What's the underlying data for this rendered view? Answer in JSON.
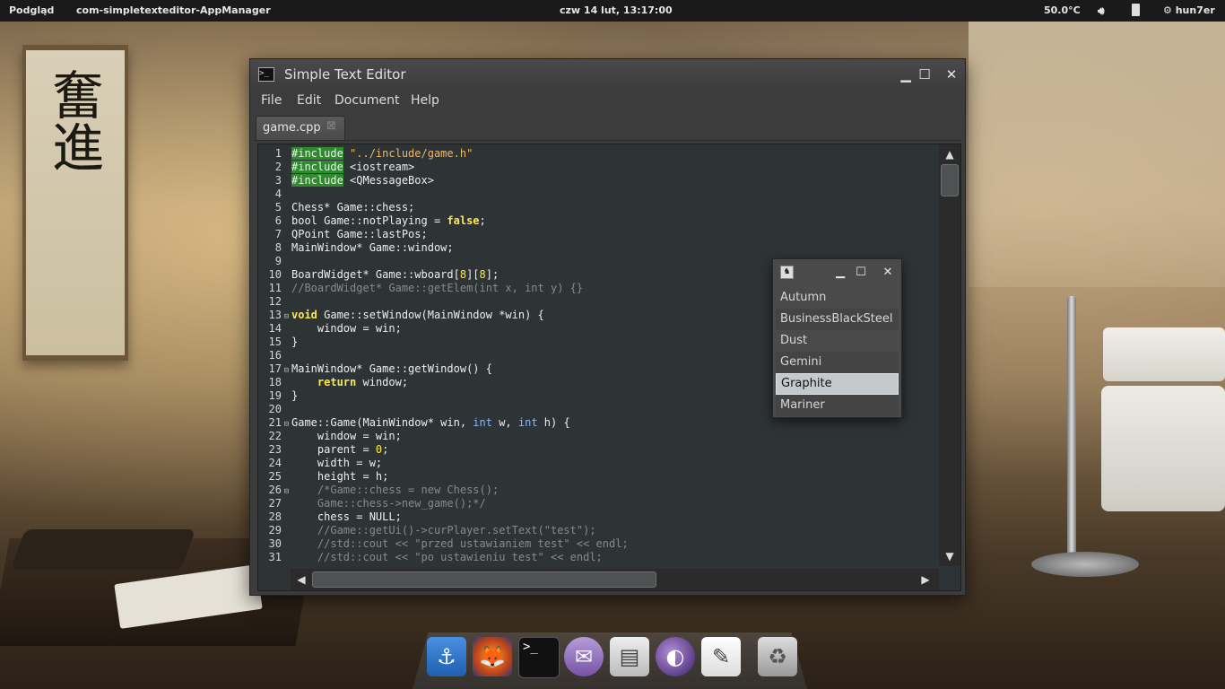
{
  "panel": {
    "app_menu": "Podgląd",
    "active_app": "com-simpletexteditor-AppManager",
    "clock": "czw 14 lut, 13:17:00",
    "temperature": "50.0°C",
    "volume_icon": "speaker-icon",
    "battery_icon": "battery-icon",
    "user": "hun7er"
  },
  "window": {
    "title": "Simple Text Editor",
    "menu": [
      "File",
      "Edit",
      "Document",
      "Help"
    ],
    "tab": {
      "label": "game.cpp",
      "close_icon": "close-icon"
    }
  },
  "editor": {
    "line_numbers": [
      "1",
      "2",
      "3",
      "4",
      "5",
      "6",
      "7",
      "8",
      "9",
      "10",
      "11",
      "12",
      "13",
      "14",
      "15",
      "16",
      "17",
      "18",
      "19",
      "20",
      "21",
      "22",
      "23",
      "24",
      "25",
      "26",
      "27",
      "28",
      "29",
      "30",
      "31"
    ],
    "fold_lines": [
      13,
      17,
      21,
      26
    ],
    "lines": [
      [
        [
          "pp",
          "#include"
        ],
        [
          "txt",
          " "
        ],
        [
          "str",
          "\"../include/game.h\""
        ]
      ],
      [
        [
          "pp",
          "#include"
        ],
        [
          "txt",
          " <iostream>"
        ]
      ],
      [
        [
          "pp",
          "#include"
        ],
        [
          "txt",
          " <QMessageBox>"
        ]
      ],
      [
        [
          "txt",
          ""
        ]
      ],
      [
        [
          "txt",
          "Chess* Game::chess;"
        ]
      ],
      [
        [
          "txt",
          "bool Game::notPlaying = "
        ],
        [
          "kw",
          "false"
        ],
        [
          "txt",
          ";"
        ]
      ],
      [
        [
          "txt",
          "QPoint Game::lastPos;"
        ]
      ],
      [
        [
          "txt",
          "MainWindow* Game::window;"
        ]
      ],
      [
        [
          "txt",
          ""
        ]
      ],
      [
        [
          "txt",
          "BoardWidget* Game::wboard["
        ],
        [
          "num",
          "8"
        ],
        [
          "txt",
          "]["
        ],
        [
          "num",
          "8"
        ],
        [
          "txt",
          "];"
        ]
      ],
      [
        [
          "com",
          "//BoardWidget* Game::getElem(int x, int y) {}"
        ]
      ],
      [
        [
          "txt",
          ""
        ]
      ],
      [
        [
          "kw",
          "void"
        ],
        [
          "txt",
          " Game::setWindow(MainWindow *win) {"
        ]
      ],
      [
        [
          "txt",
          "    window = win;"
        ]
      ],
      [
        [
          "txt",
          "}"
        ]
      ],
      [
        [
          "txt",
          ""
        ]
      ],
      [
        [
          "txt",
          "MainWindow* Game::getWindow() {"
        ]
      ],
      [
        [
          "txt",
          "    "
        ],
        [
          "kw",
          "return"
        ],
        [
          "txt",
          " window;"
        ]
      ],
      [
        [
          "txt",
          "}"
        ]
      ],
      [
        [
          "txt",
          ""
        ]
      ],
      [
        [
          "txt",
          "Game::Game(MainWindow* win, "
        ],
        [
          "type",
          "int"
        ],
        [
          "txt",
          " w, "
        ],
        [
          "type",
          "int"
        ],
        [
          "txt",
          " h) {"
        ]
      ],
      [
        [
          "txt",
          "    window = win;"
        ]
      ],
      [
        [
          "txt",
          "    parent = "
        ],
        [
          "num",
          "0"
        ],
        [
          "txt",
          ";"
        ]
      ],
      [
        [
          "txt",
          "    width = w;"
        ]
      ],
      [
        [
          "txt",
          "    height = h;"
        ]
      ],
      [
        [
          "txt",
          "    "
        ],
        [
          "com",
          "/*Game::chess = new Chess();"
        ]
      ],
      [
        [
          "com",
          "    Game::chess->new_game();*/"
        ]
      ],
      [
        [
          "txt",
          "    chess = NULL;"
        ]
      ],
      [
        [
          "com",
          "    //Game::getUi()->curPlayer.setText(\"test\");"
        ]
      ],
      [
        [
          "com",
          "    //std::cout << \"przed ustawianiem test\" << endl;"
        ]
      ],
      [
        [
          "com",
          "    //std::cout << \"po ustawieniu test\" << endl;"
        ]
      ]
    ],
    "scroll_up_icon": "chevron-up-icon",
    "scroll_down_icon": "chevron-down-icon",
    "scroll_left_icon": "chevron-left-icon",
    "scroll_right_icon": "chevron-right-icon"
  },
  "popup": {
    "items": [
      "Autumn",
      "BusinessBlackSteel",
      "Dust",
      "Gemini",
      "Graphite",
      "Mariner"
    ],
    "selected": "Graphite"
  },
  "dock": {
    "items": [
      "anchor-icon",
      "firefox-icon",
      "terminal-icon",
      "pidgin-icon",
      "file-manager-icon",
      "eclipse-icon",
      "text-editor-icon",
      "trash-icon"
    ]
  },
  "colors": {
    "editor_bg": "#2e3436",
    "preprocessor_bg": "#2e8b2e",
    "string": "#e9b96e",
    "keyword": "#fce94f",
    "comment": "#888a85",
    "selected_item": "#c5c9cc"
  }
}
